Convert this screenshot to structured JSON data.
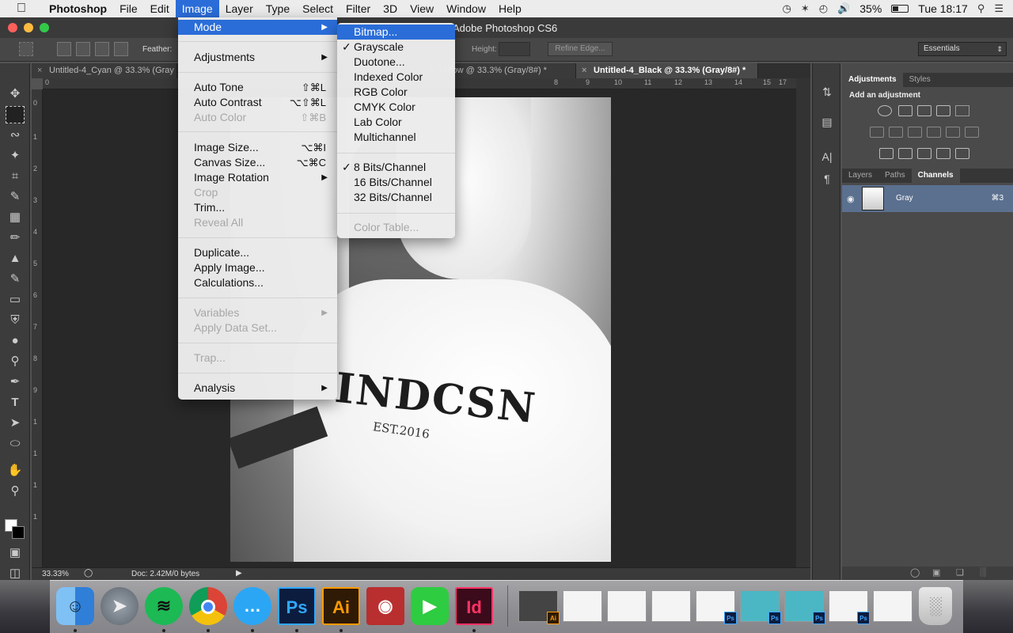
{
  "menubar": {
    "app_name": "Photoshop",
    "items": [
      "File",
      "Edit",
      "Image",
      "Layer",
      "Type",
      "Select",
      "Filter",
      "3D",
      "View",
      "Window",
      "Help"
    ],
    "battery": "35%",
    "clock": "Tue 18:17"
  },
  "window": {
    "title": "Adobe Photoshop CS6"
  },
  "options_bar": {
    "feather_label": "Feather:",
    "height_label": "Height:",
    "refine_edge": "Refine Edge...",
    "workspace": "Essentials"
  },
  "doc_tabs": [
    {
      "label": "Untitled-4_Cyan @ 33.3% (Gray",
      "active": false
    },
    {
      "label": "4_Yellow @ 33.3% (Gray/8#) *",
      "active": false
    },
    {
      "label": "Untitled-4_Black @ 33.3% (Gray/8#) *",
      "active": true
    }
  ],
  "ruler": {
    "h_ticks": [
      "0",
      "8",
      "9",
      "10",
      "11",
      "12",
      "13",
      "14",
      "15",
      "16",
      "17"
    ],
    "v_ticks": [
      "0",
      "1",
      "2",
      "3",
      "4",
      "5",
      "6",
      "7",
      "8",
      "9",
      "1",
      "1",
      "1",
      "1"
    ]
  },
  "artwork": {
    "shirt_text": "INDCSN",
    "shirt_subtext": "EST.2016"
  },
  "status": {
    "zoom": "33.33%",
    "doc": "Doc: 2.42M/0 bytes"
  },
  "image_menu": {
    "items": [
      {
        "label": "Mode",
        "highlighted": true,
        "submenu": true
      },
      {
        "label": "Adjustments",
        "submenu": true
      },
      {
        "label": "Auto Tone",
        "shortcut": "⇧⌘L"
      },
      {
        "label": "Auto Contrast",
        "shortcut": "⌥⇧⌘L"
      },
      {
        "label": "Auto Color",
        "shortcut": "⇧⌘B",
        "disabled": true
      },
      {
        "label": "Image Size...",
        "shortcut": "⌥⌘I"
      },
      {
        "label": "Canvas Size...",
        "shortcut": "⌥⌘C"
      },
      {
        "label": "Image Rotation",
        "submenu": true
      },
      {
        "label": "Crop",
        "disabled": true
      },
      {
        "label": "Trim..."
      },
      {
        "label": "Reveal All",
        "disabled": true
      },
      {
        "label": "Duplicate..."
      },
      {
        "label": "Apply Image..."
      },
      {
        "label": "Calculations..."
      },
      {
        "label": "Variables",
        "disabled": true,
        "submenu": true
      },
      {
        "label": "Apply Data Set...",
        "disabled": true
      },
      {
        "label": "Trap...",
        "disabled": true
      },
      {
        "label": "Analysis",
        "submenu": true
      }
    ]
  },
  "mode_menu": {
    "items": [
      {
        "label": "Bitmap...",
        "highlighted": true
      },
      {
        "label": "Grayscale",
        "checked": true
      },
      {
        "label": "Duotone..."
      },
      {
        "label": "Indexed Color"
      },
      {
        "label": "RGB Color"
      },
      {
        "label": "CMYK Color"
      },
      {
        "label": "Lab Color"
      },
      {
        "label": "Multichannel"
      },
      {
        "label": "8 Bits/Channel",
        "checked": true
      },
      {
        "label": "16 Bits/Channel"
      },
      {
        "label": "32 Bits/Channel"
      },
      {
        "label": "Color Table...",
        "disabled": true
      }
    ]
  },
  "panels": {
    "adjustments_tabs": [
      "Adjustments",
      "Styles"
    ],
    "add_adjustment": "Add an adjustment",
    "channel_tabs": [
      "Layers",
      "Paths",
      "Channels"
    ],
    "channel": {
      "name": "Gray",
      "shortcut": "⌘3"
    }
  },
  "dock": {
    "apps": [
      {
        "icon": "finder-icon",
        "running": true
      },
      {
        "icon": "launchpad-icon",
        "running": false
      },
      {
        "icon": "spotify-icon",
        "running": true
      },
      {
        "icon": "chrome-icon",
        "running": true
      },
      {
        "icon": "messages-icon",
        "running": true
      },
      {
        "icon": "photoshop-icon",
        "label": "Ps",
        "running": true
      },
      {
        "icon": "illustrator-icon",
        "label": "Ai",
        "running": true
      },
      {
        "icon": "photo-booth-icon",
        "running": false
      },
      {
        "icon": "facetime-icon",
        "running": false
      },
      {
        "icon": "indesign-icon",
        "label": "Id",
        "running": true
      }
    ],
    "minimized_badges": [
      "Ai",
      "Ps",
      "Ps",
      "Ps",
      "Ps"
    ]
  },
  "colors": {
    "menu_highlight": "#2a6dd9",
    "channel_selected": "#5b6f8f",
    "ps_badge": "#31a8ff",
    "ai_badge": "#ff9a00",
    "id_badge": "#ff3366"
  }
}
